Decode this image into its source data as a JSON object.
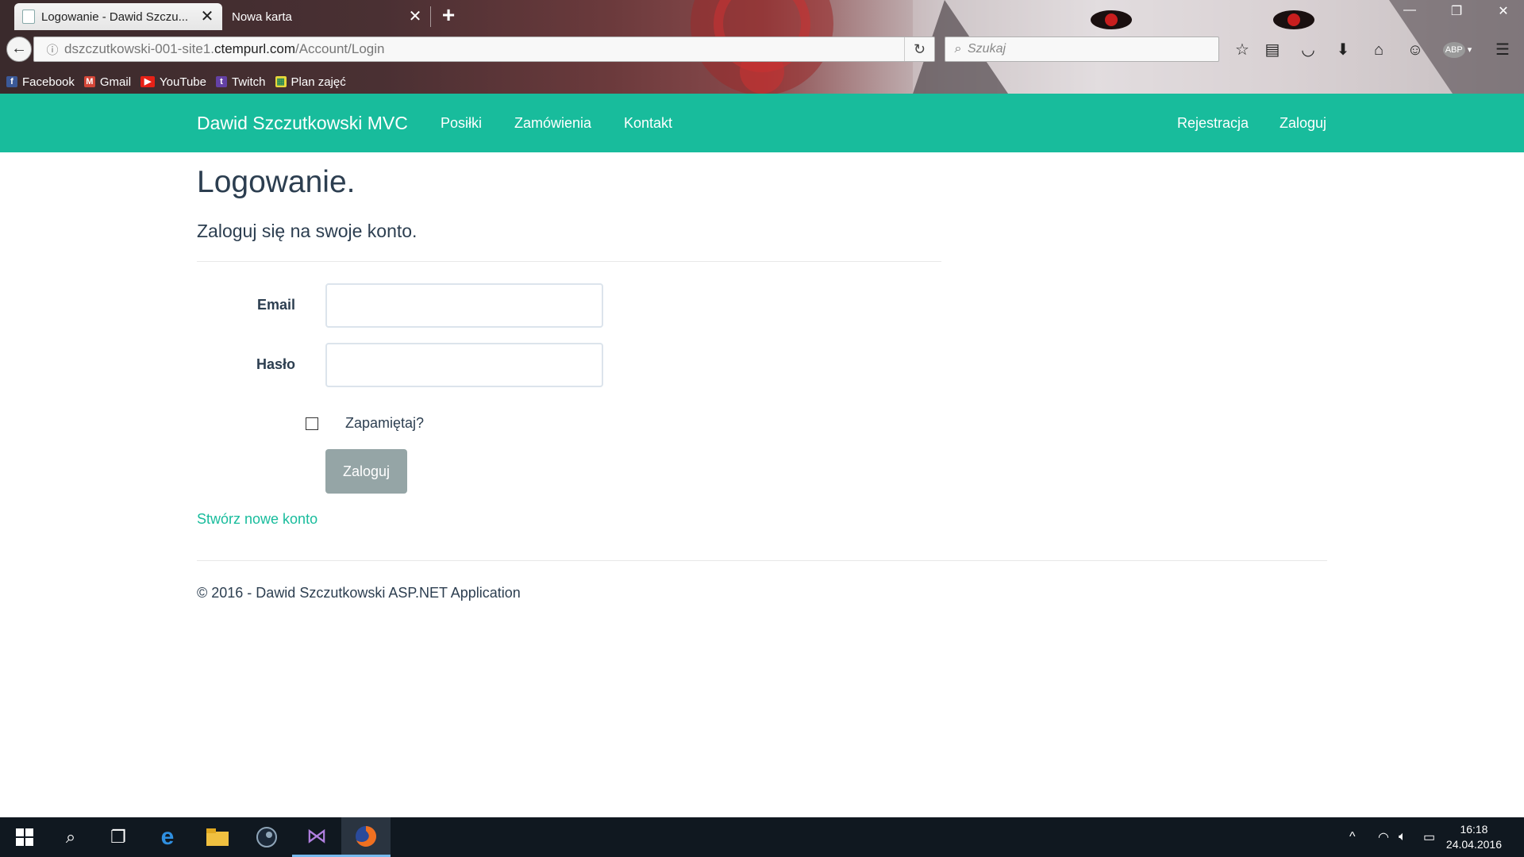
{
  "browser": {
    "tabs": [
      {
        "title": "Logowanie - Dawid Szczu...",
        "active": true
      },
      {
        "title": "Nowa karta",
        "active": false
      }
    ],
    "url": {
      "prefix": "dszczutkowski-001-site1.",
      "host": "ctempurl.com",
      "path": "/Account/Login"
    },
    "search_placeholder": "Szukaj",
    "bookmarks": [
      {
        "label": "Facebook",
        "icon": "facebook-icon",
        "color": "#3b5998"
      },
      {
        "label": "Gmail",
        "icon": "gmail-icon",
        "color": "#d44638"
      },
      {
        "label": "YouTube",
        "icon": "youtube-icon",
        "color": "#e62117"
      },
      {
        "label": "Twitch",
        "icon": "twitch-icon",
        "color": "#6441a5"
      },
      {
        "label": "Plan zajęć",
        "icon": "calendar-icon",
        "color": "#2e8b57"
      }
    ],
    "toolbar_icons": [
      "bookmark-star-icon",
      "reading-list-icon",
      "pocket-icon",
      "download-icon",
      "home-icon",
      "smiley-icon",
      "adblock-icon",
      "menu-icon"
    ],
    "adblock_label": "ABP"
  },
  "site": {
    "brand": "Dawid Szczutkowski MVC",
    "nav_left": [
      "Posiłki",
      "Zamówienia",
      "Kontakt"
    ],
    "nav_right": [
      "Rejestracja",
      "Zaloguj"
    ],
    "accent_color": "#18bc9c"
  },
  "login": {
    "heading": "Logowanie.",
    "subtitle": "Zaloguj się na swoje konto.",
    "email_label": "Email",
    "email_value": "",
    "password_label": "Hasło",
    "password_value": "",
    "remember_label": "Zapamiętaj?",
    "remember_checked": false,
    "submit_label": "Zaloguj",
    "register_link": "Stwórz nowe konto"
  },
  "footer": {
    "text": "© 2016 - Dawid Szczutkowski ASP.NET Application"
  },
  "taskbar": {
    "apps": [
      "windows-start-icon",
      "search-icon",
      "task-view-icon",
      "edge-icon",
      "file-explorer-icon",
      "steam-icon",
      "visual-studio-icon",
      "firefox-icon"
    ],
    "time": "16:18",
    "date": "24.04.2016"
  }
}
